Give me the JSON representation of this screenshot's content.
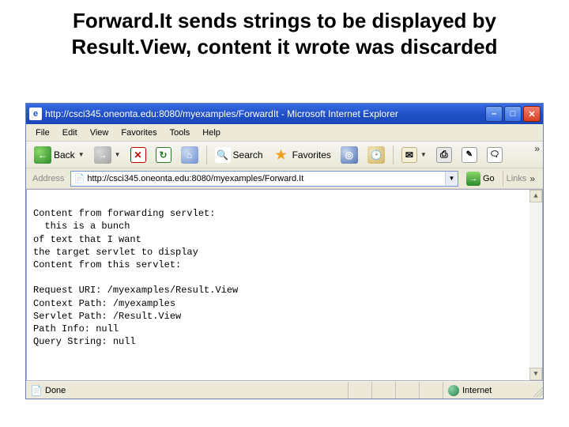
{
  "slide": {
    "title": "Forward.It sends strings to be displayed by Result.View, content it wrote was discarded"
  },
  "titlebar": {
    "text": "http://csci345.oneonta.edu:8080/myexamples/ForwardIt - Microsoft Internet Explorer"
  },
  "menu": {
    "file": "File",
    "edit": "Edit",
    "view": "View",
    "favorites": "Favorites",
    "tools": "Tools",
    "help": "Help"
  },
  "toolbar": {
    "back": "Back",
    "search": "Search",
    "favorites": "Favorites"
  },
  "address": {
    "label": "Address",
    "value": "http://csci345.oneonta.edu:8080/myexamples/Forward.It",
    "go": "Go",
    "links": "Links"
  },
  "page": {
    "line1": "Content from forwarding servlet:",
    "line2": "  this is a bunch",
    "line3": "of text that I want",
    "line4": "the target servlet to display",
    "line5": "Content from this servlet:",
    "blank": "",
    "uri": "Request URI: /myexamples/Result.View",
    "ctx": "Context Path: /myexamples",
    "srv": "Servlet Path: /Result.View",
    "pinfo": "Path Info: null",
    "qs": "Query String: null"
  },
  "status": {
    "done": "Done",
    "zone": "Internet"
  }
}
